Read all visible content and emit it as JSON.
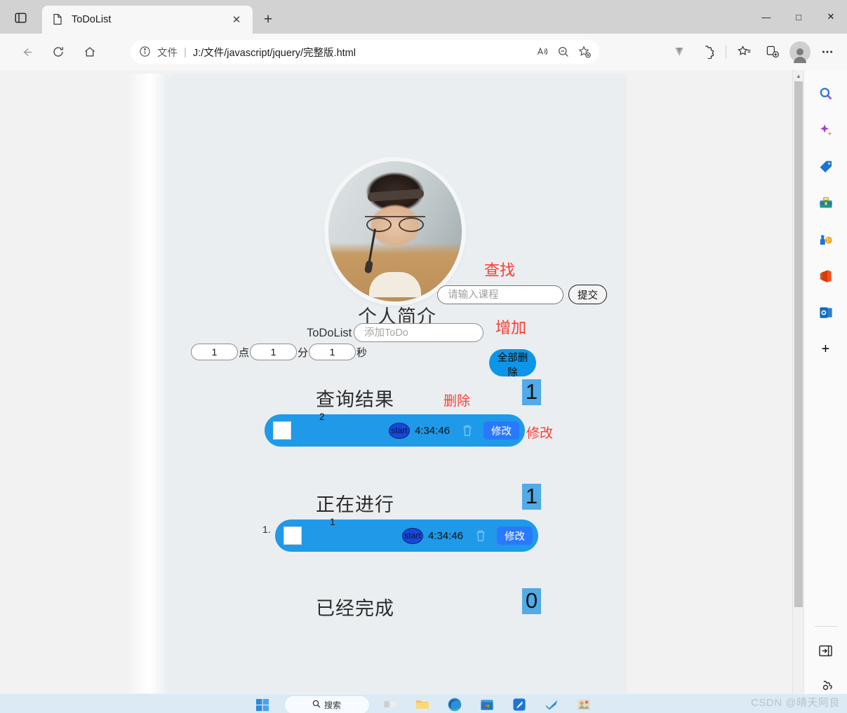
{
  "browser": {
    "tab": {
      "title": "ToDoList",
      "favicon_icon": "document-icon",
      "close_icon": "close-icon"
    },
    "tab_actions_icon": "tab-actions-icon",
    "new_tab_label": "+",
    "window_controls": {
      "minimize": "—",
      "maximize": "□",
      "close": "✕"
    },
    "nav": {
      "back_icon": "back-arrow-icon",
      "reload_icon": "reload-icon",
      "home_icon": "home-icon"
    },
    "omnibox": {
      "info_icon": "info-circle-icon",
      "scheme_label": "文件",
      "separator": "|",
      "url": "J:/文件/javascript/jquery/完整版.html",
      "read_aloud_icon": "read-aloud-icon",
      "zoom_out_icon": "zoom-out-icon",
      "add_favorite_icon": "add-favorite-icon"
    },
    "toolbar": [
      {
        "name": "downloads-v-icon",
        "glyph": "▼"
      },
      {
        "name": "extensions-icon",
        "glyph": "⚙"
      },
      {
        "name": "collections-icon",
        "glyph": "☆"
      },
      {
        "name": "split-screen-icon",
        "glyph": "⧉"
      },
      {
        "name": "profile-avatar",
        "glyph": ""
      },
      {
        "name": "settings-more-icon",
        "glyph": "⋯"
      }
    ]
  },
  "sidebar": {
    "items": [
      {
        "name": "sidebar-search-icon",
        "label": "搜索"
      },
      {
        "name": "sidebar-copilot-icon",
        "label": "Copilot"
      },
      {
        "name": "sidebar-shopping-icon",
        "label": "购物"
      },
      {
        "name": "sidebar-tools-icon",
        "label": "工具"
      },
      {
        "name": "sidebar-games-icon",
        "label": "游戏"
      },
      {
        "name": "sidebar-office-icon",
        "label": "Office"
      },
      {
        "name": "sidebar-outlook-icon",
        "label": "Outlook"
      },
      {
        "name": "sidebar-add-icon",
        "label": "+"
      }
    ],
    "expand_icon": "expand-sidebar-icon",
    "settings_icon": "sidebar-settings-icon"
  },
  "page": {
    "avatar_name": "profile-photo",
    "profile_title": "个人简介",
    "search": {
      "note": "查找",
      "placeholder": "请输入课程",
      "value": "",
      "submit_label": "提交"
    },
    "add": {
      "note": "增加",
      "list_label": "ToDoList",
      "placeholder": "添加ToDo",
      "value": ""
    },
    "time": {
      "hour": "1",
      "hour_unit": "点",
      "minute": "1",
      "minute_unit": "分",
      "second": "1",
      "second_unit": "秒"
    },
    "clear_all_label": "全部删除",
    "sections": [
      {
        "title": "查询结果",
        "count": "1",
        "notes": [
          {
            "text": "删除"
          },
          {
            "text": "修改"
          }
        ],
        "items": [
          {
            "marker": "",
            "text": "2",
            "checked": false,
            "start_label": "start",
            "time": "4:34:46",
            "delete_icon": "trash-icon",
            "edit_label": "修改"
          }
        ]
      },
      {
        "title": "正在进行",
        "count": "1",
        "notes": [],
        "items": [
          {
            "marker": "1.",
            "text": "1",
            "checked": false,
            "start_label": "start",
            "time": "4:34:46",
            "delete_icon": "trash-icon",
            "edit_label": "修改"
          }
        ]
      },
      {
        "title": "已经完成",
        "count": "0",
        "notes": [],
        "items": []
      }
    ]
  },
  "taskbar": {
    "start_icon": "windows-start-icon",
    "search_label": "搜索",
    "search_icon": "search-icon",
    "items": [
      {
        "name": "taskview-icon"
      },
      {
        "name": "file-explorer-icon"
      },
      {
        "name": "edge-browser-icon"
      },
      {
        "name": "microsoft-store-icon"
      },
      {
        "name": "app-blue-icon"
      },
      {
        "name": "app-check-icon"
      },
      {
        "name": "app-photo-icon"
      }
    ]
  },
  "watermark": "CSDN @晴天阿良",
  "colors": {
    "accent_blue": "#1f9ae8",
    "edit_blue": "#2979ff",
    "badge_blue": "#52aae6",
    "red_note": "#ff3b30",
    "page_bg": "#eaeef1"
  }
}
